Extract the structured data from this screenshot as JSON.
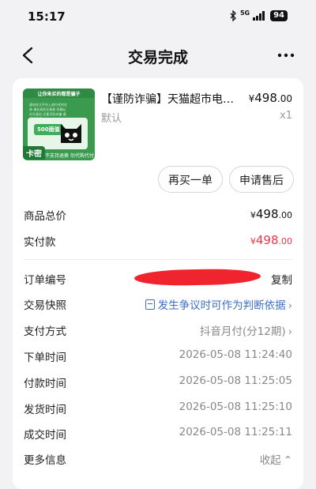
{
  "status": {
    "time": "15:17",
    "network": "5G",
    "battery": "94"
  },
  "nav": {
    "title": "交易完成"
  },
  "product": {
    "image_caption": "让你来买的都是骗子",
    "image_text": "请勿在大平台上进行任何交易 请在高危交易前 先确认对方身份 注意识别诈骗 请仔细阅读",
    "image_amount": "500面值",
    "image_badge": "卡密",
    "image_bottom": "不支持退换 勿代购代付",
    "title": "【谨防诈骗】天猫超市电…",
    "price_yen": "¥",
    "price_int": "498",
    "price_dec": ".00",
    "spec": "默认",
    "qty": "x1"
  },
  "actions": {
    "rebuy": "再买一单",
    "aftersale": "申请售后"
  },
  "summary": {
    "total_label": "商品总价",
    "total_yen": "¥",
    "total_int": "498",
    "total_dec": ".00",
    "paid_label": "实付款",
    "paid_yen": "¥",
    "paid_int": "498",
    "paid_dec": ".00"
  },
  "details": {
    "order_no_label": "订单编号",
    "copy": "复制",
    "snapshot_label": "交易快照",
    "snapshot_value": "发生争议时可作为判断依据",
    "pay_method_label": "支付方式",
    "pay_method_value": "抖音月付(分12期)",
    "order_time_label": "下单时间",
    "order_time": "2026-05-08 11:24:40",
    "pay_time_label": "付款时间",
    "pay_time": "2026-05-08 11:25:05",
    "ship_time_label": "发货时间",
    "ship_time": "2026-05-08 11:25:10",
    "done_time_label": "成交时间",
    "done_time": "2026-05-08 11:25:11",
    "more_label": "更多信息",
    "collapse": "收起"
  },
  "colors": {
    "accent_red": "#e8364a",
    "link_blue": "#3b6fc4"
  }
}
